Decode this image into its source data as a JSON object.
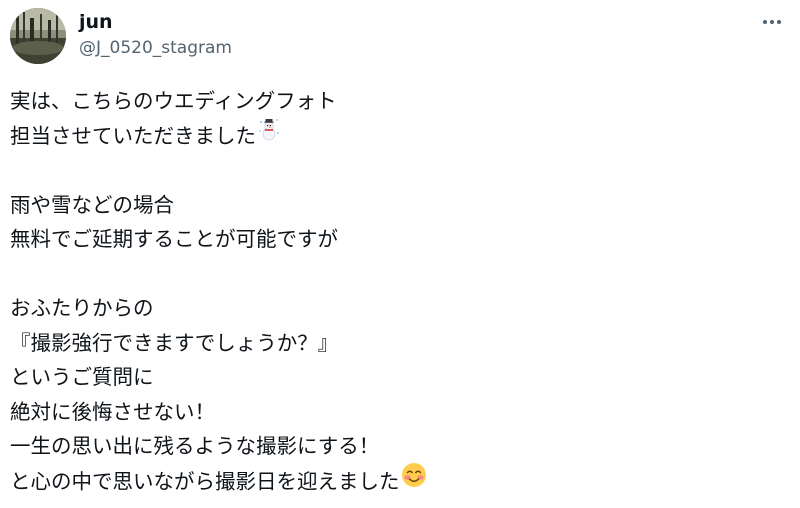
{
  "author": {
    "display_name": "jun",
    "handle": "@J_0520_stagram",
    "avatar_icon": "landscape-avatar"
  },
  "menu_icon": "more-options-icon",
  "tweet": {
    "lines": [
      "実は、こちらのウエディングフォト",
      "担当させていただきました",
      "",
      "雨や雪などの場合",
      "無料でご延期することが可能ですが",
      "",
      "おふたりからの",
      "『撮影強行できますでしょうか？』",
      "というご質問に",
      "絶対に後悔させない！",
      "一生の思い出に残るような撮影にする！",
      "と心の中で思いながら撮影日を迎えました"
    ],
    "emojis": {
      "line2": "snowman-icon",
      "line12": "smiling-blush-face-icon"
    }
  },
  "colors": {
    "text": "#0f1419",
    "secondary": "#536471",
    "background": "#ffffff"
  }
}
